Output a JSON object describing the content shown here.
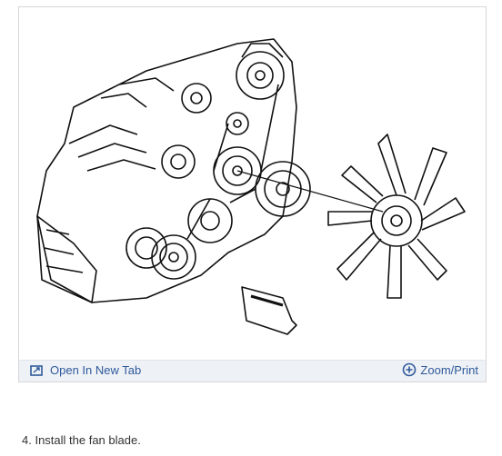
{
  "figure": {
    "open_tab_label": "Open In New Tab",
    "zoom_label": "Zoom/Print",
    "open_tab_icon": "open-in-new-tab-icon",
    "zoom_icon": "zoom-plus-circle-icon",
    "accent_color": "#2f5a9a",
    "toolbar_bg": "#eef1f6"
  },
  "step": {
    "caption": "4. Install the fan blade."
  }
}
